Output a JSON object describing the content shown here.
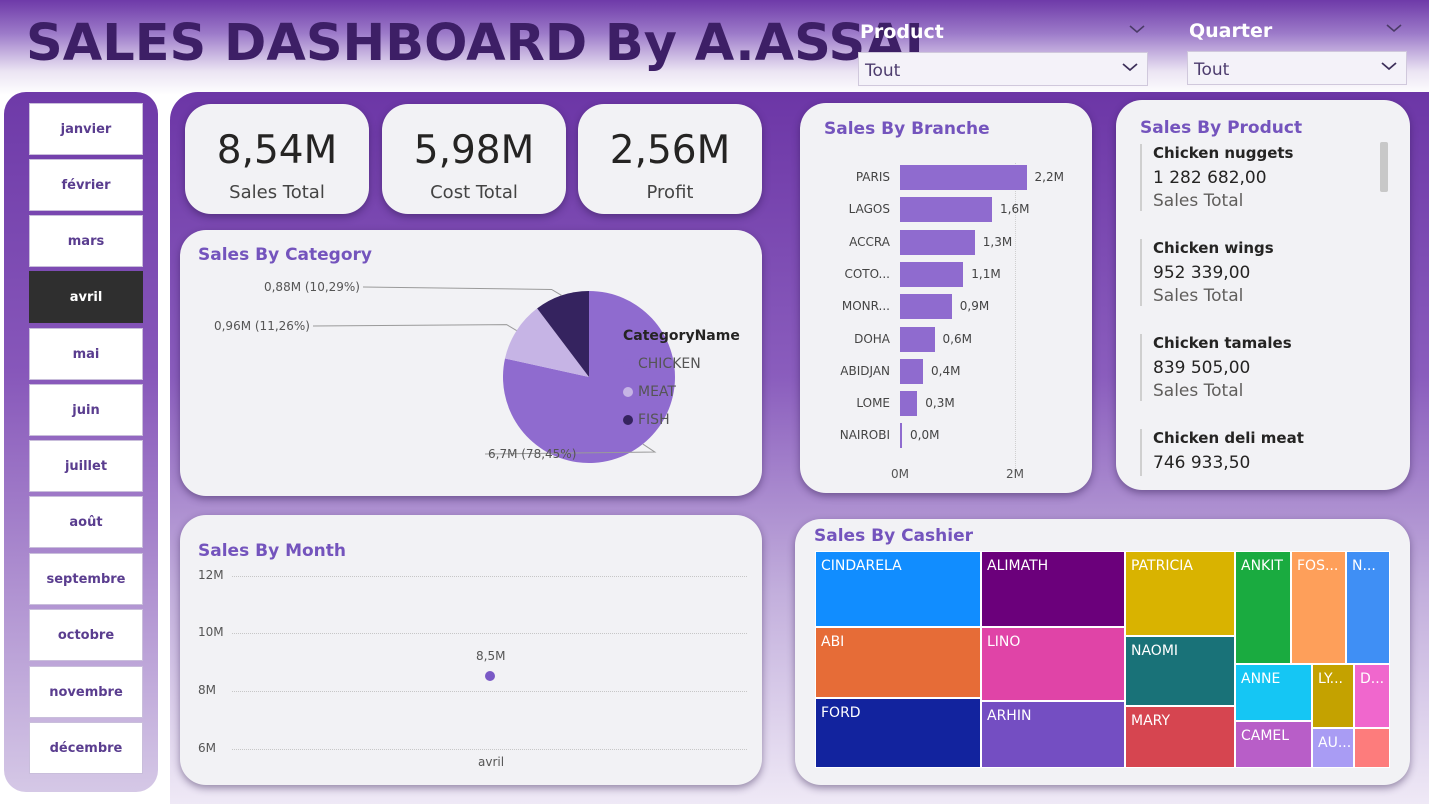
{
  "header": {
    "title": "SALES DASHBOARD By A.ASSAL"
  },
  "slicers": {
    "product": {
      "title": "Product",
      "value": "Tout"
    },
    "quarter": {
      "title": "Quarter",
      "value": "Tout"
    }
  },
  "months": [
    {
      "label": "janvier"
    },
    {
      "label": "février"
    },
    {
      "label": "mars"
    },
    {
      "label": "avril",
      "active": true
    },
    {
      "label": "mai"
    },
    {
      "label": "juin"
    },
    {
      "label": "juillet"
    },
    {
      "label": "août"
    },
    {
      "label": "septembre"
    },
    {
      "label": "octobre"
    },
    {
      "label": "novembre"
    },
    {
      "label": "décembre"
    }
  ],
  "kpis": [
    {
      "value": "8,54M",
      "label": "Sales Total"
    },
    {
      "value": "5,98M",
      "label": "Cost Total"
    },
    {
      "value": "2,56M",
      "label": "Profit"
    }
  ],
  "category_card": {
    "title": "Sales By Category",
    "legend_title": "CategoryName",
    "slices": [
      {
        "name": "CHICKEN",
        "value": 6.7,
        "label": "6,7M (78,45%)",
        "color": "#8f6bcf"
      },
      {
        "name": "MEAT",
        "value": 0.96,
        "label": "0,96M (11,26%)",
        "color": "#c6b4e5"
      },
      {
        "name": "FISH",
        "value": 0.88,
        "label": "0,88M (10,29%)",
        "color": "#35235f"
      }
    ]
  },
  "branch_card": {
    "title": "Sales By Branche",
    "bars": [
      {
        "name": "PARIS",
        "value": 2.2,
        "label": "2,2M"
      },
      {
        "name": "LAGOS",
        "value": 1.6,
        "label": "1,6M"
      },
      {
        "name": "ACCRA",
        "value": 1.3,
        "label": "1,3M"
      },
      {
        "name": "COTO...",
        "value": 1.1,
        "label": "1,1M"
      },
      {
        "name": "MONR...",
        "value": 0.9,
        "label": "0,9M"
      },
      {
        "name": "DOHA",
        "value": 0.6,
        "label": "0,6M"
      },
      {
        "name": "ABIDJAN",
        "value": 0.4,
        "label": "0,4M"
      },
      {
        "name": "LOME",
        "value": 0.3,
        "label": "0,3M"
      },
      {
        "name": "NAIROBI",
        "value": 0.02,
        "label": "0,0M"
      }
    ],
    "x_ticks": [
      "0M",
      "2M"
    ]
  },
  "product_card": {
    "title": "Sales By Product",
    "items": [
      {
        "name": "Chicken nuggets",
        "value": "1 282 682,00",
        "label": "Sales Total"
      },
      {
        "name": "Chicken wings",
        "value": "952 339,00",
        "label": "Sales Total"
      },
      {
        "name": "Chicken tamales",
        "value": "839 505,00",
        "label": "Sales Total"
      },
      {
        "name": "Chicken deli meat",
        "value": "746 933,50",
        "label": ""
      }
    ]
  },
  "month_card": {
    "title": "Sales By Month",
    "y_ticks": [
      "12M",
      "10M",
      "8M",
      "6M"
    ],
    "point_label": "8,5M",
    "x_label": "avril"
  },
  "cashier_card": {
    "title": "Sales By Cashier",
    "cells": [
      {
        "name": "CINDARELA",
        "color": "#118dff"
      },
      {
        "name": "ALIMATH",
        "color": "#6b007b"
      },
      {
        "name": "PATRICIA",
        "color": "#d9b300"
      },
      {
        "name": "ANKIT",
        "color": "#1aab40"
      },
      {
        "name": "FOS...",
        "color": "#fe9f5a"
      },
      {
        "name": "N...",
        "color": "#3f8ff5"
      },
      {
        "name": "ABI",
        "color": "#e66c37"
      },
      {
        "name": "LINO",
        "color": "#e044a7"
      },
      {
        "name": "NAOMI",
        "color": "#197278"
      },
      {
        "name": "ANNE",
        "color": "#15c6f4"
      },
      {
        "name": "LY...",
        "color": "#c4a200"
      },
      {
        "name": "D...",
        "color": "#f067cd"
      },
      {
        "name": "FORD",
        "color": "#12239e"
      },
      {
        "name": "ARHIN",
        "color": "#744ec2"
      },
      {
        "name": "MARY",
        "color": "#d64550"
      },
      {
        "name": "CAMEL",
        "color": "#b85ec8"
      },
      {
        "name": "AU...",
        "color": "#a99cf4"
      },
      {
        "name": "",
        "color": "#fd7c7c"
      }
    ]
  },
  "chart_data": [
    {
      "type": "pie",
      "title": "Sales By Category",
      "legend_title": "CategoryName",
      "categories": [
        "CHICKEN",
        "MEAT",
        "FISH"
      ],
      "values": [
        6.7,
        0.96,
        0.88
      ],
      "data_labels": [
        "6,7M (78,45%)",
        "0,96M (11,26%)",
        "0,88M (10,29%)"
      ]
    },
    {
      "type": "bar",
      "title": "Sales By Branche",
      "categories": [
        "PARIS",
        "LAGOS",
        "ACCRA",
        "COTO...",
        "MONR...",
        "DOHA",
        "ABIDJAN",
        "LOME",
        "NAIROBI"
      ],
      "values": [
        2.2,
        1.6,
        1.3,
        1.1,
        0.9,
        0.6,
        0.4,
        0.3,
        0.0
      ],
      "xlim": [
        0,
        2.4
      ]
    },
    {
      "type": "scatter",
      "title": "Sales By Month",
      "x": [
        "avril"
      ],
      "y": [
        8.5
      ],
      "ylim": [
        6,
        12
      ]
    }
  ]
}
